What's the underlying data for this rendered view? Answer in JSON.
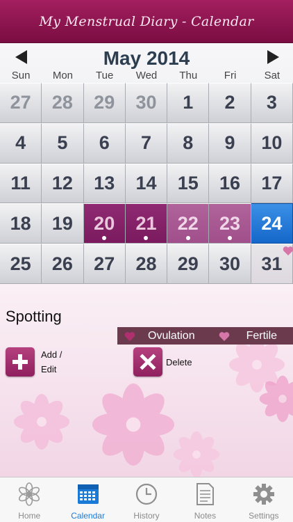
{
  "header": {
    "title": "My Menstrual Diary - Calendar"
  },
  "calendar": {
    "month_title": "May 2014",
    "weekdays": [
      "Sun",
      "Mon",
      "Tue",
      "Wed",
      "Thu",
      "Fri",
      "Sat"
    ],
    "weeks": [
      [
        "27",
        "28",
        "29",
        "30",
        "1",
        "2",
        "3"
      ],
      [
        "4",
        "5",
        "6",
        "7",
        "8",
        "9",
        "10"
      ],
      [
        "11",
        "12",
        "13",
        "14",
        "15",
        "16",
        "17"
      ],
      [
        "18",
        "19",
        "20",
        "21",
        "22",
        "23",
        "24"
      ],
      [
        "25",
        "26",
        "27",
        "28",
        "29",
        "30",
        "31"
      ]
    ],
    "today": "24",
    "period_days": [
      "20",
      "21",
      "22",
      "23"
    ]
  },
  "detail": {
    "day_label": "Spotting",
    "legend": {
      "ovulation": "Ovulation",
      "fertile": "Fertile"
    },
    "add_label_line1": "Add /",
    "add_label_line2": "Edit",
    "delete_label": "Delete"
  },
  "tabs": [
    {
      "label": "Home",
      "icon": "flower-icon"
    },
    {
      "label": "Calendar",
      "icon": "calendar-icon"
    },
    {
      "label": "History",
      "icon": "clock-icon"
    },
    {
      "label": "Notes",
      "icon": "notes-icon"
    },
    {
      "label": "Settings",
      "icon": "gear-icon"
    }
  ],
  "colors": {
    "header": "#8b1650",
    "period": "#8f2a72",
    "today": "#1567c9",
    "legend_bar": "#6b3b4d",
    "ovulation_heart": "#b0306f",
    "fertile_heart": "#d776a8",
    "active_tab": "#1a7ad8"
  }
}
